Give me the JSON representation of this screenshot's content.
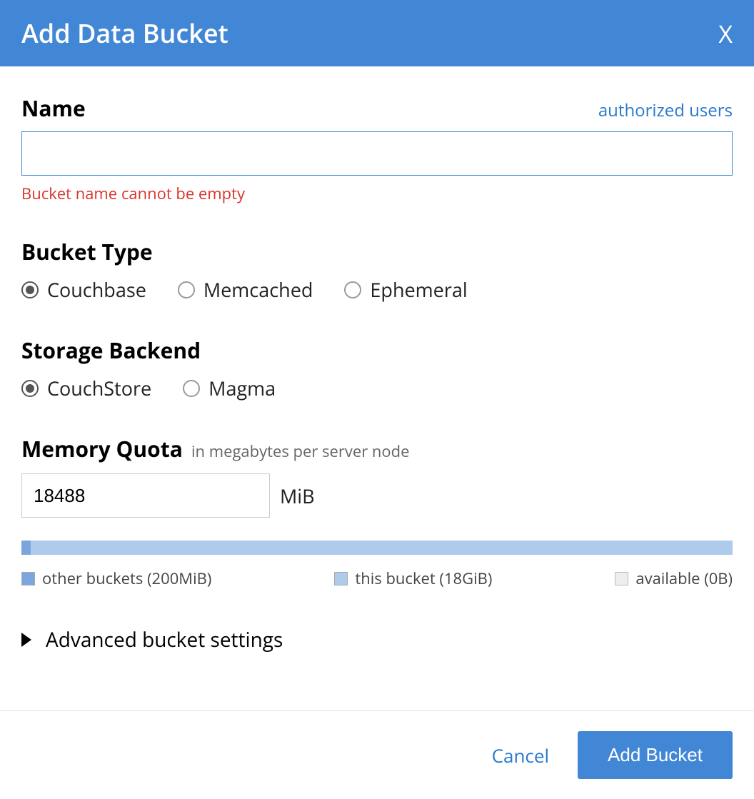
{
  "header": {
    "title": "Add Data Bucket",
    "close_glyph": "X"
  },
  "name_section": {
    "label": "Name",
    "auth_link": "authorized users",
    "value": "",
    "error": "Bucket name cannot be empty"
  },
  "bucket_type": {
    "label": "Bucket Type",
    "options": [
      {
        "label": "Couchbase",
        "selected": true
      },
      {
        "label": "Memcached",
        "selected": false
      },
      {
        "label": "Ephemeral",
        "selected": false
      }
    ]
  },
  "storage_backend": {
    "label": "Storage Backend",
    "options": [
      {
        "label": "CouchStore",
        "selected": true
      },
      {
        "label": "Magma",
        "selected": false
      }
    ]
  },
  "memory_quota": {
    "label": "Memory Quota",
    "hint": "in megabytes per server node",
    "value": "18488",
    "unit": "MiB",
    "legend": {
      "other": "other buckets (200MiB)",
      "this": "this bucket (18GiB)",
      "available": "available (0B)"
    }
  },
  "advanced": {
    "label": "Advanced bucket settings"
  },
  "footer": {
    "cancel": "Cancel",
    "submit": "Add Bucket"
  }
}
